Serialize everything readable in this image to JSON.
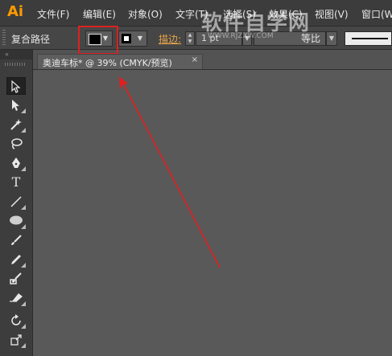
{
  "app": {
    "logo": "Ai"
  },
  "menu": [
    {
      "label": "文件(F)"
    },
    {
      "label": "编辑(E)"
    },
    {
      "label": "对象(O)"
    },
    {
      "label": "文字(T)"
    },
    {
      "label": "选择(S)"
    },
    {
      "label": "效果(C)"
    },
    {
      "label": "视图(V)"
    },
    {
      "label": "窗口(W"
    }
  ],
  "watermark": {
    "text": "软件自学网",
    "url": "WWW.RJZXW.COM"
  },
  "control_bar": {
    "selection_label": "复合路径",
    "fill_color": "#000000",
    "stroke_icon": "stroke-swatch-icon",
    "stroke_label": "描边:",
    "stroke_weight_value": "1 pt",
    "ratio_label": "等比",
    "highlight_color": "#e02020"
  },
  "document": {
    "tab_title": "奥迪车标* @ 39% (CMYK/预览)",
    "close_glyph": "×"
  },
  "tools": [
    {
      "name": "selection-tool-icon"
    },
    {
      "name": "direct-selection-tool-icon"
    },
    {
      "name": "magic-wand-tool-icon"
    },
    {
      "name": "lasso-tool-icon"
    },
    {
      "name": "pen-tool-icon"
    },
    {
      "name": "type-tool-icon",
      "glyph": "T"
    },
    {
      "name": "line-segment-tool-icon"
    },
    {
      "name": "ellipse-tool-icon"
    },
    {
      "name": "paintbrush-tool-icon"
    },
    {
      "name": "pencil-tool-icon"
    },
    {
      "name": "blob-brush-tool-icon"
    },
    {
      "name": "eraser-tool-icon"
    },
    {
      "name": "rotate-tool-icon"
    },
    {
      "name": "scale-tool-icon"
    }
  ],
  "annotation": {
    "arrow_color": "#e02020"
  }
}
